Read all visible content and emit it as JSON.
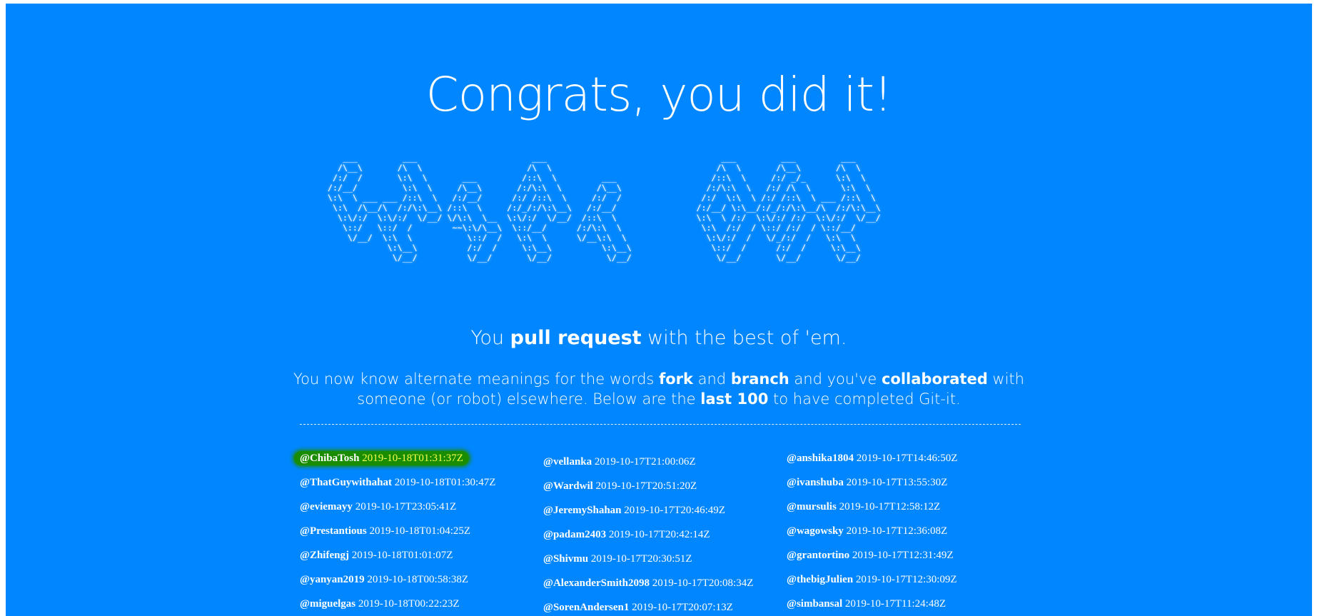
{
  "title": "Congrats, you did it!",
  "ascii_art": "   ___         ___                       ___                                   ___         ___         ___     \n  /\\__\\       /\\  \\                     /\\  \\                                 /\\  \\       /\\__\\       /\\  \\    \n /:/  /       \\:\\  \\       ___         /::\\  \\         ___                   /::\\  \\     /:/ _/_      \\:\\  \\   \n/:/__/         \\:\\  \\     /\\__\\       /:/\\:\\  \\       /\\__\\                 /:/\\:\\  \\   /:/ /\\  \\      \\:\\  \\  \n\\:\\  \\ ___ ___ /::\\  \\   /:/__/      /:/ /::\\  \\     /:/  /                /:/  \\:\\  \\ /:/ /::\\  \\ ___ /::\\  \\ \n \\:\\  /\\__/\\  /:/\\:\\__\\ /::\\  \\     /:/_/:/\\:\\__\\   /:/__/                /:/__/ \\:\\__/:/_/:/\\:\\__/\\  /:/\\:\\__\\\n  \\:\\/:/  \\:\\/:/  \\/__/ \\/\\:\\  \\__  \\:\\/:/  \\/__/  /::\\  \\                \\:\\  \\ /:/  \\:\\/:/ /:/  \\:\\/:/  \\/__/\n   \\::/   \\::/  /        ~~\\:\\/\\__\\  \\::/__/      /:/\\:\\  \\                \\:\\  /:/  / \\::/ /:/  / \\::/__/     \n    \\/__/  \\:\\  \\           \\::/  /   \\:\\  \\      \\/__\\:\\  \\                \\:\\/:/  /   \\/_/:/  /   \\:\\  \\     \n            \\:\\__\\          /:/  /     \\:\\__\\          \\:\\__\\                \\::/  /      /:/  /     \\:\\__\\    \n             \\/__/          \\/__/       \\/__/           \\/__/                 \\/__/       \\/__/       \\/__/    ",
  "tagline": {
    "pre": "You ",
    "bold": "pull request",
    "post": " with the best of 'em."
  },
  "description": {
    "p1": "You now know alternate meanings for the words ",
    "b1": "fork",
    "p2": " and ",
    "b2": "branch",
    "p3": " and you've ",
    "b3": "collaborated",
    "p4": " with someone (or robot) elsewhere. Below are the ",
    "b4": "last 100",
    "p5": " to have completed Git-it."
  },
  "colors": {
    "background": "#0086ff",
    "highlight": "#1a8c00",
    "highlight_text": "#f5ff4a"
  },
  "completions": {
    "col1": [
      {
        "user": "@ChibaTosh",
        "time": "2019-10-18T01:31:37Z"
      },
      {
        "user": "@ThatGuywithahat",
        "time": "2019-10-18T01:30:47Z"
      },
      {
        "user": "@eviemayy",
        "time": "2019-10-17T23:05:41Z"
      },
      {
        "user": "@Prestantious",
        "time": "2019-10-18T01:04:25Z"
      },
      {
        "user": "@Zhifengj",
        "time": "2019-10-18T01:01:07Z"
      },
      {
        "user": "@yanyan2019",
        "time": "2019-10-18T00:58:38Z"
      },
      {
        "user": "@miguelgas",
        "time": "2019-10-18T00:22:23Z"
      }
    ],
    "col2": [
      {
        "user": "@vellanka",
        "time": "2019-10-17T21:00:06Z"
      },
      {
        "user": "@Wardwil",
        "time": "2019-10-17T20:51:20Z"
      },
      {
        "user": "@JeremyShahan",
        "time": "2019-10-17T20:46:49Z"
      },
      {
        "user": "@padam2403",
        "time": "2019-10-17T20:42:14Z"
      },
      {
        "user": "@Shivmu",
        "time": "2019-10-17T20:30:51Z"
      },
      {
        "user": "@AlexanderSmith2098",
        "time": "2019-10-17T20:08:34Z"
      },
      {
        "user": "@SorenAndersen1",
        "time": "2019-10-17T20:07:13Z"
      }
    ],
    "col3": [
      {
        "user": "@anshika1804",
        "time": "2019-10-17T14:46:50Z"
      },
      {
        "user": "@ivanshuba",
        "time": "2019-10-17T13:55:30Z"
      },
      {
        "user": "@mursulis",
        "time": "2019-10-17T12:58:12Z"
      },
      {
        "user": "@wagowsky",
        "time": "2019-10-17T12:36:08Z"
      },
      {
        "user": "@grantortino",
        "time": "2019-10-17T12:31:49Z"
      },
      {
        "user": "@thebigJulien",
        "time": "2019-10-17T12:30:09Z"
      },
      {
        "user": "@simbansal",
        "time": "2019-10-17T11:24:48Z"
      }
    ]
  }
}
